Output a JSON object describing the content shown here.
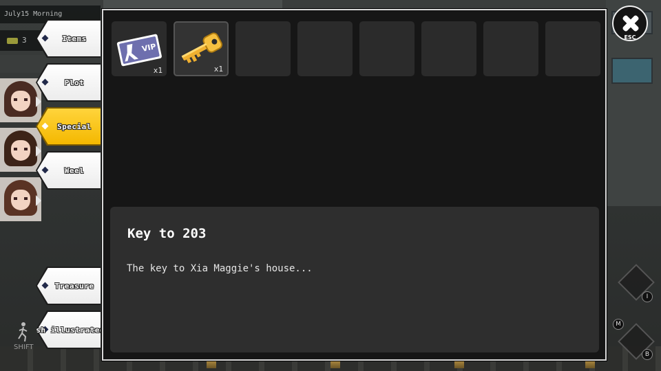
{
  "hud": {
    "date": "July15 Morning",
    "money": "3"
  },
  "categories": [
    {
      "label": "Items",
      "active": false
    },
    {
      "label": "Plot",
      "active": false
    },
    {
      "label": "Special",
      "active": true
    },
    {
      "label": "Weel",
      "active": false
    },
    {
      "label": "Treasure",
      "active": false
    },
    {
      "label": "fish illustrated b",
      "active": false
    }
  ],
  "inventory": {
    "slots": [
      {
        "item": "vip-card",
        "icon_text": "VIP",
        "qty": "x1"
      },
      {
        "item": "key",
        "qty": "x1",
        "selected": true
      },
      {
        "item": null
      },
      {
        "item": null
      },
      {
        "item": null
      },
      {
        "item": null
      },
      {
        "item": null
      },
      {
        "item": null
      }
    ]
  },
  "detail": {
    "title": "Key to 203",
    "description": "The key to Xia Maggie's house..."
  },
  "close": {
    "label": "ESC"
  },
  "hotkeys": {
    "i": "I",
    "m": "M",
    "b": "B",
    "shift": "SHIFT"
  },
  "colors": {
    "active_tab": "#f4b800",
    "panel_bg": "#161616",
    "desc_bg": "#2e2e2e",
    "key_gold": "#f0b030",
    "vip_card": "#7a7ac0"
  }
}
